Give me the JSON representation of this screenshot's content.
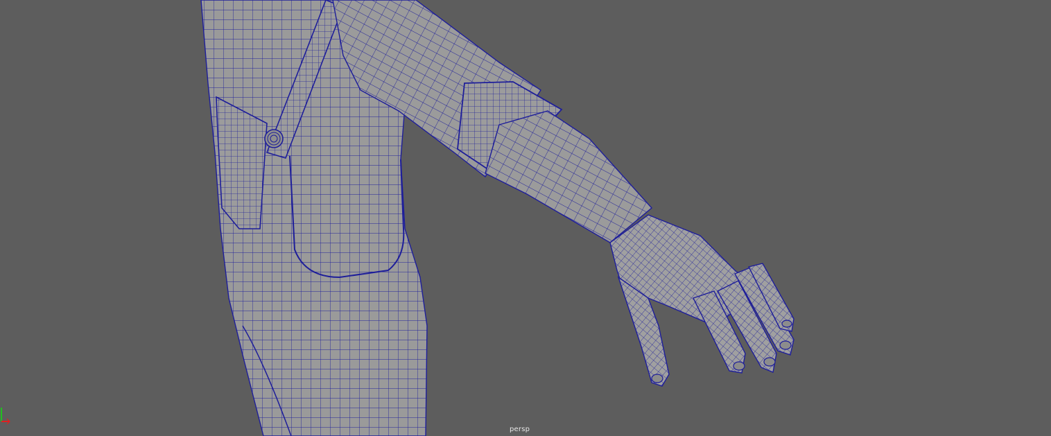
{
  "viewport": {
    "camera_label": "persp",
    "background_color": "#5d5d5d",
    "mesh_fill_color": "#9a9a9a",
    "wireframe_color": "#1e1e9a",
    "display_mode": "wireframe-on-shaded"
  },
  "axis_gizmo": {
    "x_color": "#e02020",
    "y_color": "#20c020",
    "icon": "xyz-axis-icon"
  }
}
